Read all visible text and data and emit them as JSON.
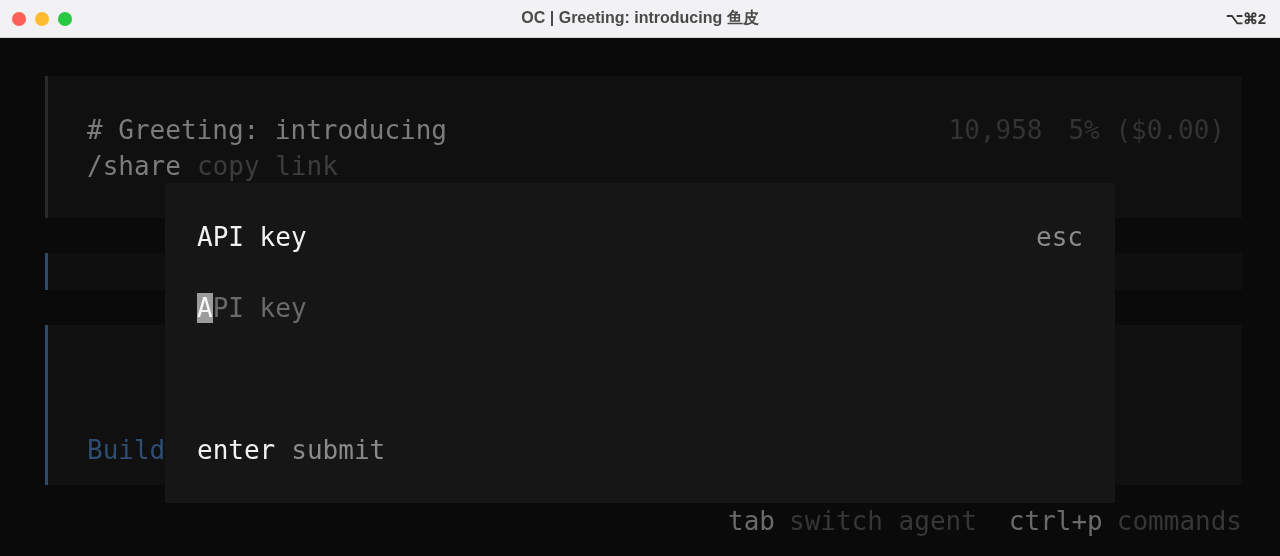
{
  "window": {
    "title": "OC | Greeting: introducing 鱼皮",
    "shortcut": "⌥⌘2"
  },
  "header": {
    "title": "# Greeting: introducing",
    "tokens": "10,958",
    "usage": "5% ($0.00)",
    "share": {
      "key": "/share",
      "label": "copy link"
    }
  },
  "message": {
    "text": "Build"
  },
  "dialog": {
    "title": "API key",
    "close_hint": "esc",
    "field": {
      "placeholder": "API key",
      "focused": true
    },
    "submit": {
      "key": "enter",
      "label": "submit"
    }
  },
  "footer_hints": [
    {
      "key": "tab",
      "label": "switch agent"
    },
    {
      "key": "ctrl+p",
      "label": "commands"
    }
  ]
}
